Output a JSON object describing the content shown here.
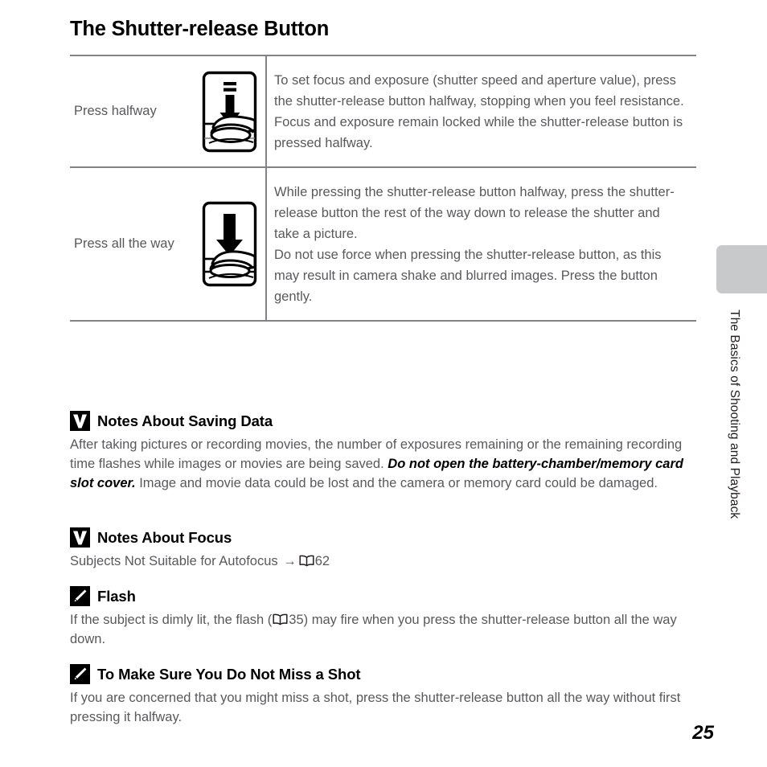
{
  "page": {
    "title": "The Shutter-release Button",
    "number": "25",
    "chapter_tab_label": "The Basics of Shooting and Playback"
  },
  "table": {
    "rows": [
      {
        "label": "Press halfway",
        "icon": "shutter-press-halfway-icon",
        "description": "To set focus and exposure (shutter speed and aperture value), press the shutter-release button halfway, stopping when you feel resistance. Focus and exposure remain locked while the shutter-release button is pressed halfway."
      },
      {
        "label": "Press all the way",
        "icon": "shutter-press-all-the-way-icon",
        "description_1": "While pressing the shutter-release button halfway, press the shutter-release button the rest of the way down to release the shutter and take a picture.",
        "description_2": "Do not use force when pressing the shutter-release button, as this may result in camera shake and blurred images. Press the button gently."
      }
    ]
  },
  "notes": [
    {
      "icon": "caution-check-icon",
      "title": "Notes About Saving Data",
      "body_part_1": "After taking pictures or recording movies, the number of exposures remaining or the remaining recording time flashes while images or movies are being saved. ",
      "body_emphasis": "Do not open the battery-chamber/memory card slot cover.",
      "body_part_2": " Image and movie data could be lost and the camera or memory card could be damaged."
    },
    {
      "icon": "caution-check-icon",
      "title": "Notes About Focus",
      "body_part_1": "Subjects Not Suitable for Autofocus ",
      "arrow": "→",
      "reference_icon": "open-book-icon",
      "reference_page": "62"
    },
    {
      "icon": "tip-pencil-icon",
      "title": "Flash",
      "body_part_1": "If the subject is dimly lit, the flash (",
      "reference_icon": "open-book-icon",
      "reference_page": "35",
      "body_part_2": ") may fire when you press the shutter-release button all the way down."
    },
    {
      "icon": "tip-pencil-icon",
      "title": "To Make Sure You Do Not Miss a Shot",
      "body_part_1": "If you are concerned that you might miss a shot, press the shutter-release button all the way without first pressing it halfway."
    }
  ],
  "colors": {
    "body_text": "#58595b",
    "heading_text": "#000000",
    "rule": "#808285",
    "tab": "#c8c9ca"
  }
}
